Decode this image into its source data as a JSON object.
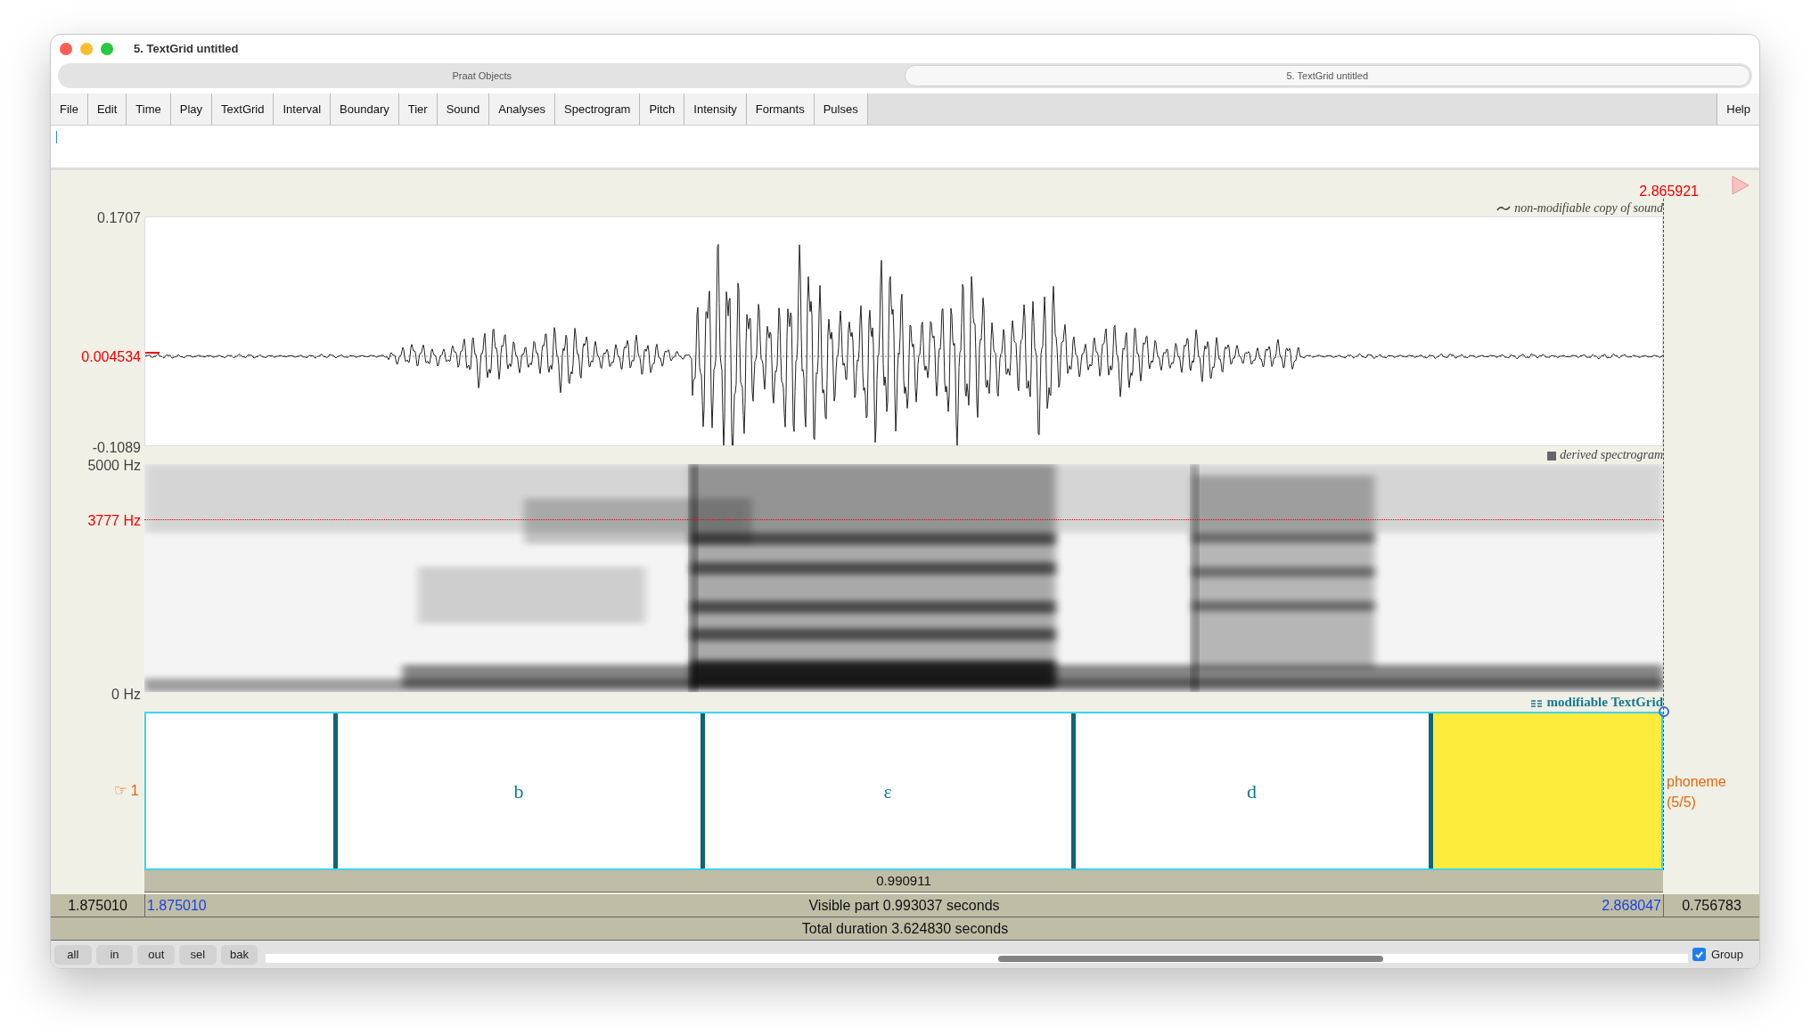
{
  "window": {
    "title": "5. TextGrid untitled"
  },
  "tabs": [
    {
      "label": "Praat Objects",
      "selected": false
    },
    {
      "label": "5. TextGrid untitled",
      "selected": true
    }
  ],
  "menu": [
    "File",
    "Edit",
    "Time",
    "Play",
    "TextGrid",
    "Interval",
    "Boundary",
    "Tier",
    "Sound",
    "Analyses",
    "Spectrogram",
    "Pitch",
    "Intensity",
    "Formants",
    "Pulses"
  ],
  "help": "Help",
  "sound": {
    "cursor_time": "2.865921",
    "label": "non-modifiable copy of sound",
    "ymax": "0.1707",
    "cursor_value": "0.004534",
    "ymin": "-0.1089"
  },
  "spectrogram": {
    "label": "derived spectrogram",
    "fmax": "5000 Hz",
    "cursor_freq": "3777 Hz",
    "fmin": "0 Hz"
  },
  "textgrid": {
    "label": "modifiable TextGrid",
    "tiers": [
      {
        "marker": "☞",
        "number": "1",
        "name": "phoneme",
        "count": "(5/5)",
        "intervals": [
          {
            "selected": false
          },
          {
            "text": "b",
            "selected": false
          },
          {
            "text": "ɛ",
            "selected": false
          },
          {
            "text": "d",
            "selected": false
          },
          {
            "selected": true
          }
        ]
      }
    ]
  },
  "selection_duration": "0.990911",
  "left_time": "1.875010",
  "window_start": "1.875010",
  "visible": "Visible part 0.993037 seconds",
  "window_end": "2.868047",
  "right_time": "0.756783",
  "total": "Total duration 3.624830 seconds",
  "zoom_buttons": [
    "all",
    "in",
    "out",
    "sel",
    "bak"
  ],
  "group": {
    "label": "Group",
    "checked": true
  }
}
